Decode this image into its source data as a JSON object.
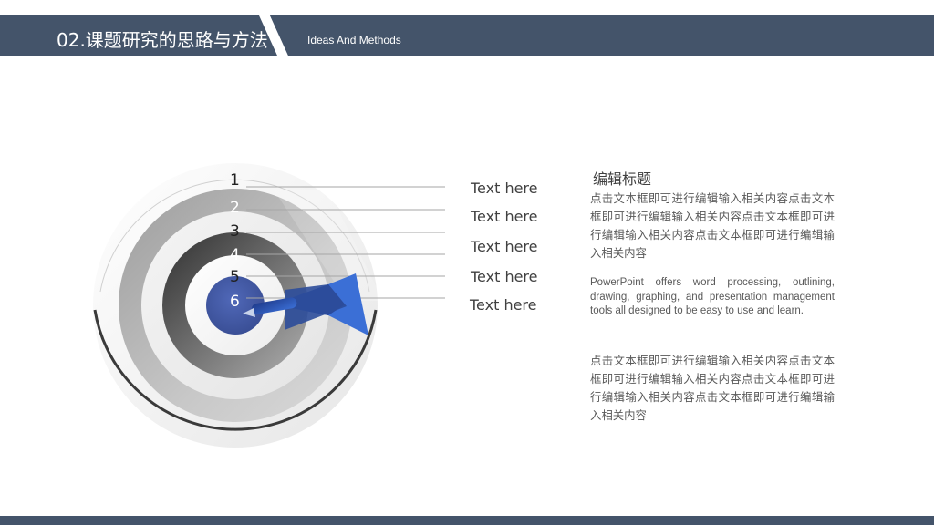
{
  "header": {
    "title": "02.课题研究的思路与方法",
    "subtitle": "Ideas And Methods"
  },
  "target": {
    "rings": [
      "1",
      "2",
      "3",
      "4",
      "5",
      "6"
    ]
  },
  "labels": [
    "Text here",
    "Text here",
    "Text here",
    "Text here",
    "Text here"
  ],
  "content": {
    "heading": "编辑标题",
    "para1": "点击文本框即可进行编辑输入相关内容点击文本框即可进行编辑输入相关内容点击文本框即可进行编辑输入相关内容点击文本框即可进行编辑输入相关内容",
    "para_en": "PowerPoint offers word processing, outlining, drawing, graphing, and presentation management tools all designed to be easy to use and learn.",
    "para2": "点击文本框即可进行编辑输入相关内容点击文本框即可进行编辑输入相关内容点击文本框即可进行编辑输入相关内容点击文本框即可进行编辑输入相关内容"
  },
  "colors": {
    "header_bg": "#44546a",
    "dart_blue": "#3b62c4",
    "bullseye": "#3e59a8"
  }
}
